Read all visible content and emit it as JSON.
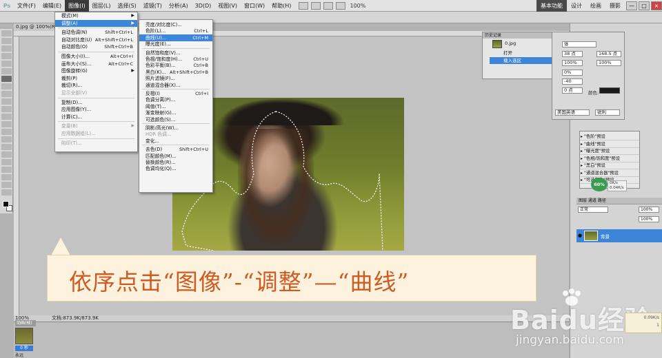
{
  "menubar": {
    "logo": "Ps",
    "items": [
      "文件(F)",
      "编辑(E)",
      "图像(I)",
      "图层(L)",
      "选择(S)",
      "滤镜(T)",
      "分析(A)",
      "3D(D)",
      "视图(V)",
      "窗口(W)",
      "帮助(H)"
    ],
    "active_index": 2,
    "zoom": "100%",
    "workspaces": [
      "基本功能",
      "设计",
      "绘画",
      "摄影"
    ],
    "window_controls": [
      "—",
      "□",
      "×"
    ]
  },
  "document": {
    "tab": "0.jpg @ 100%(RGB",
    "status_zoom": "100%",
    "status_doc": "文档:873.9K/873.9K"
  },
  "filmstrip": {
    "label": "动画(帧)",
    "frame_name": "0 秒",
    "frame_caption": "永远"
  },
  "image_menu": {
    "items": [
      {
        "label": "模式(M)",
        "shortcut": "",
        "submenu": true,
        "disabled": false
      },
      {
        "label": "调整(A)",
        "shortcut": "",
        "submenu": true,
        "disabled": false,
        "highlight": true
      },
      {
        "sep": true
      },
      {
        "label": "自动色调(N)",
        "shortcut": "Shift+Ctrl+L"
      },
      {
        "label": "自动对比度(U)",
        "shortcut": "Alt+Shift+Ctrl+L"
      },
      {
        "label": "自动颜色(O)",
        "shortcut": "Shift+Ctrl+B"
      },
      {
        "sep": true
      },
      {
        "label": "图像大小(I)...",
        "shortcut": "Alt+Ctrl+I"
      },
      {
        "label": "画布大小(S)...",
        "shortcut": "Alt+Ctrl+C"
      },
      {
        "label": "图像旋转(G)",
        "shortcut": "",
        "submenu": true
      },
      {
        "label": "裁剪(P)",
        "shortcut": ""
      },
      {
        "label": "裁切(R)...",
        "shortcut": ""
      },
      {
        "label": "显示全部(V)",
        "shortcut": "",
        "disabled": true
      },
      {
        "sep": true
      },
      {
        "label": "复制(D)...",
        "shortcut": ""
      },
      {
        "label": "应用图像(Y)...",
        "shortcut": ""
      },
      {
        "label": "计算(C)...",
        "shortcut": ""
      },
      {
        "sep": true
      },
      {
        "label": "变量(B)",
        "shortcut": "",
        "submenu": true,
        "disabled": true
      },
      {
        "label": "应用数据组(L)...",
        "shortcut": "",
        "disabled": true
      },
      {
        "sep": true
      },
      {
        "label": "陷印(T)...",
        "shortcut": "",
        "disabled": true
      }
    ]
  },
  "adjust_menu": {
    "items": [
      {
        "label": "亮度/对比度(C)...",
        "shortcut": ""
      },
      {
        "label": "色阶(L)...",
        "shortcut": "Ctrl+L"
      },
      {
        "label": "曲线(U)...",
        "shortcut": "Ctrl+M",
        "highlight": true
      },
      {
        "label": "曝光度(E)...",
        "shortcut": ""
      },
      {
        "sep": true
      },
      {
        "label": "自然饱和度(V)...",
        "shortcut": ""
      },
      {
        "label": "色相/饱和度(H)...",
        "shortcut": "Ctrl+U"
      },
      {
        "label": "色彩平衡(B)...",
        "shortcut": "Ctrl+B"
      },
      {
        "label": "黑白(K)...",
        "shortcut": "Alt+Shift+Ctrl+B"
      },
      {
        "label": "照片滤镜(F)...",
        "shortcut": ""
      },
      {
        "label": "通道混合器(X)...",
        "shortcut": ""
      },
      {
        "sep": true
      },
      {
        "label": "反相(I)",
        "shortcut": "Ctrl+I"
      },
      {
        "label": "色调分离(P)...",
        "shortcut": ""
      },
      {
        "label": "阈值(T)...",
        "shortcut": ""
      },
      {
        "label": "渐变映射(G)...",
        "shortcut": ""
      },
      {
        "label": "可选颜色(S)...",
        "shortcut": ""
      },
      {
        "sep": true
      },
      {
        "label": "阴影/高光(W)...",
        "shortcut": ""
      },
      {
        "label": "HDR 色调...",
        "shortcut": "",
        "disabled": true
      },
      {
        "label": "变化...",
        "shortcut": ""
      },
      {
        "sep": true
      },
      {
        "label": "去色(D)",
        "shortcut": "Shift+Ctrl+U"
      },
      {
        "label": "匹配颜色(M)...",
        "shortcut": ""
      },
      {
        "label": "替换颜色(R)...",
        "shortcut": ""
      },
      {
        "label": "色调均化(Q)...",
        "shortcut": ""
      }
    ]
  },
  "history": {
    "tab": "历史记录",
    "file": "0.jpg",
    "rows": [
      "打开",
      "载入选区"
    ],
    "selected_index": 1
  },
  "character": {
    "font": "体",
    "size": "38 点",
    "leading": "168.5 点",
    "scale_v": "100%",
    "scale_h": "100%",
    "tracking": "0%",
    "kerning": "-40",
    "baseline": "0 点",
    "color_label": "颜色:",
    "language": "美国英语",
    "aa": "锐利"
  },
  "actions": {
    "items": [
      "\"色阶\"预设",
      "\"曲线\"预设",
      "\"曝光度\"预设",
      "\"色相/饱和度\"预设",
      "\"黑白\"预设",
      "\"通道混合器\"预设",
      "\"可选颜色\"预设"
    ],
    "gauge": "60%",
    "speed_up": "0K/s",
    "speed_down": "0.04K/s"
  },
  "layers": {
    "tabs": "图层  通道  路径",
    "blend": "正常",
    "opacity": "100%",
    "fill": "100%",
    "layer_name": "背景"
  },
  "callout": {
    "text": "依序点击“图像”-“调整”—“曲线”"
  },
  "watermark": {
    "brand": "Baidu经验",
    "url": "jingyan.baidu.com"
  },
  "mini_badge": {
    "line1": "0.09K/s",
    "line2": "1"
  },
  "colors": {
    "highlight": "#3d85d8",
    "callout_text": "#cf5a23",
    "callout_bg": "#fdf2dd"
  }
}
